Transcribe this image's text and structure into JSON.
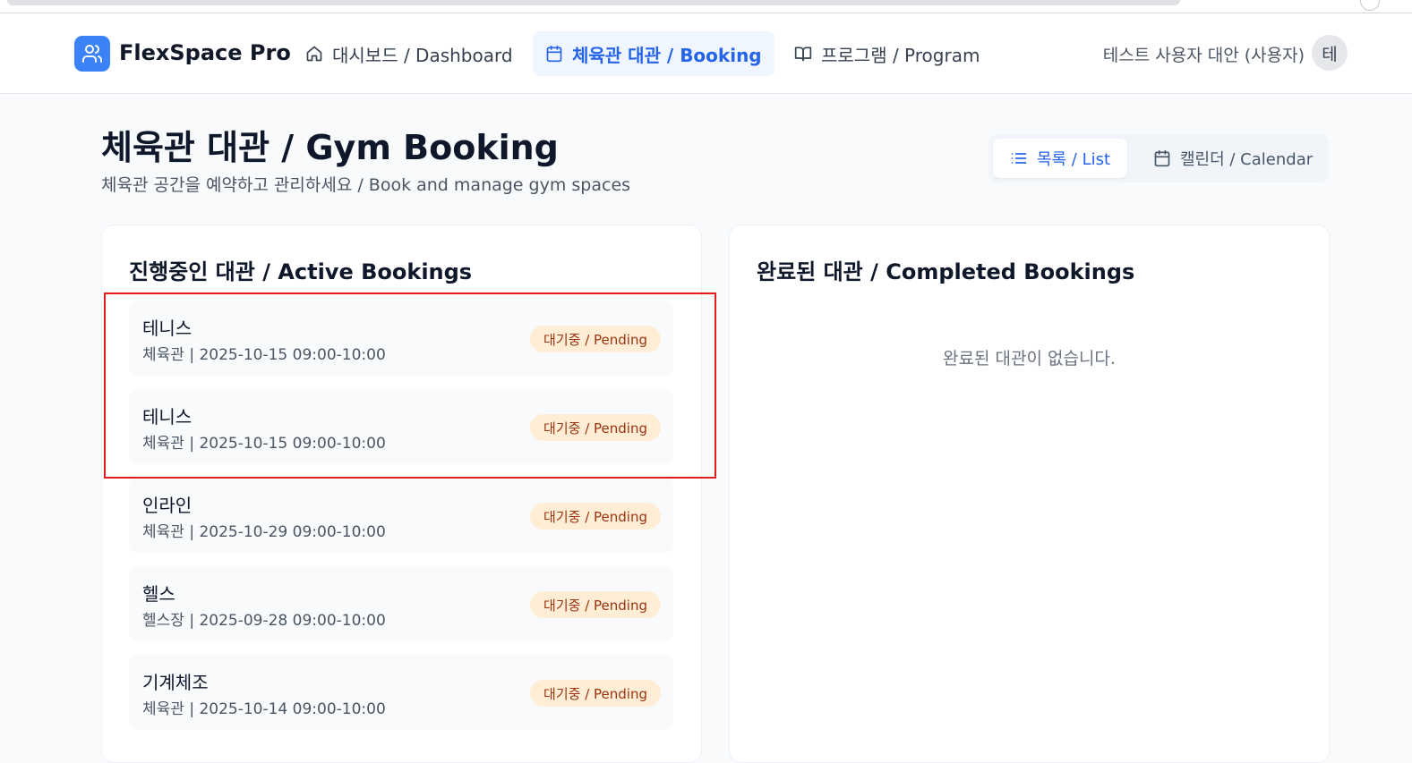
{
  "app": {
    "name": "FlexSpace Pro"
  },
  "nav": {
    "items": [
      {
        "label": "대시보드 / Dashboard",
        "icon": "home-icon"
      },
      {
        "label": "체육관 대관 / Booking",
        "icon": "calendar-icon",
        "active": true
      },
      {
        "label": "프로그램 / Program",
        "icon": "book-open-icon"
      }
    ],
    "user_name": "테스트 사용자 대안 (사용자)",
    "avatar_initial": "테"
  },
  "page": {
    "title": "체육관 대관 / Gym Booking",
    "subtitle": "체육관 공간을 예약하고 관리하세요 / Book and manage gym spaces"
  },
  "view_toggle": {
    "list_label": "목록 / List",
    "calendar_label": "캘린더 / Calendar",
    "selected": "list"
  },
  "active_bookings": {
    "title": "진행중인 대관 / Active Bookings",
    "items": [
      {
        "name": "테니스",
        "detail": "체육관 | 2025-10-15 09:00-10:00",
        "status": "대기중 / Pending"
      },
      {
        "name": "테니스",
        "detail": "체육관 | 2025-10-15 09:00-10:00",
        "status": "대기중 / Pending"
      },
      {
        "name": "인라인",
        "detail": "체육관 | 2025-10-29 09:00-10:00",
        "status": "대기중 / Pending"
      },
      {
        "name": "헬스",
        "detail": "헬스장 | 2025-09-28 09:00-10:00",
        "status": "대기중 / Pending"
      },
      {
        "name": "기계체조",
        "detail": "체육관 | 2025-10-14 09:00-10:00",
        "status": "대기중 / Pending"
      }
    ]
  },
  "completed_bookings": {
    "title": "완료된 대관 / Completed Bookings",
    "empty_message": "완료된 대관이 없습니다."
  },
  "colors": {
    "accent": "#3b82f6",
    "active_nav_bg": "#eff6ff",
    "pending_badge_bg": "#ffedd5",
    "pending_badge_text": "#9a3412",
    "highlight": "#e11d1d"
  }
}
